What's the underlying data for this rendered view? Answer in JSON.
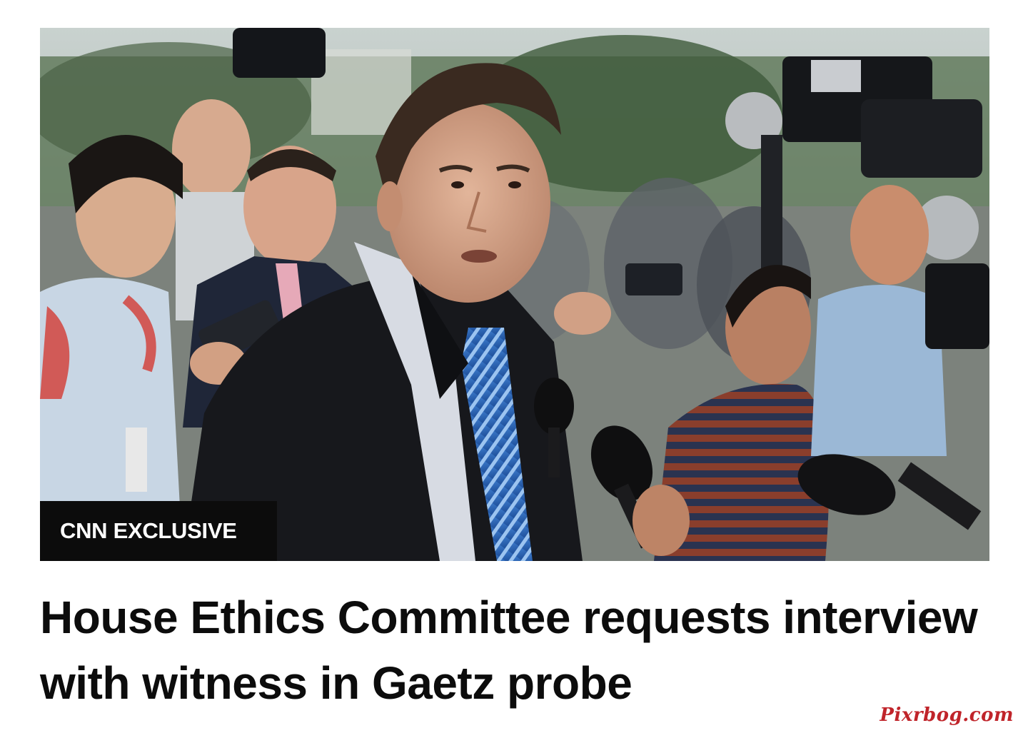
{
  "story": {
    "badge_label": "CNN EXCLUSIVE",
    "headline": "House Ethics Committee requests interview with witness in Gaetz probe",
    "photo": {
      "description_icon": "press-scrum-photo",
      "dominant_colors": [
        "#6f7a73",
        "#1b1d22",
        "#2f6fbf",
        "#8a5a3f"
      ]
    }
  },
  "watermark": {
    "text": "Pixrbog.com",
    "color": "#c0242a"
  }
}
